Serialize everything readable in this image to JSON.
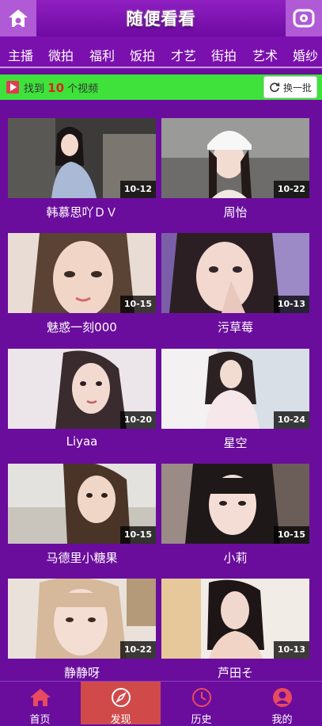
{
  "header": {
    "title": "随便看看"
  },
  "categories": [
    "主播",
    "微拍",
    "福利",
    "饭拍",
    "才艺",
    "街拍",
    "艺术",
    "婚纱"
  ],
  "findbar": {
    "prefix": "找到",
    "count": "10",
    "suffix": "个视频",
    "refresh_label": "换一批"
  },
  "videos": [
    {
      "title": "韩慕思吖ＤＶ",
      "date": "10-12"
    },
    {
      "title": "周怡",
      "date": "10-22"
    },
    {
      "title": "魅惑一刻000",
      "date": "10-15"
    },
    {
      "title": "污草莓",
      "date": "10-13"
    },
    {
      "title": "Liyaa",
      "date": "10-20"
    },
    {
      "title": "星空",
      "date": "10-24"
    },
    {
      "title": "马德里小糖果",
      "date": "10-15"
    },
    {
      "title": "小莉",
      "date": "10-15"
    },
    {
      "title": "静静呀",
      "date": "10-22"
    },
    {
      "title": "芦田そ",
      "date": "10-13"
    }
  ],
  "nav": [
    {
      "label": "首页",
      "icon": "home-icon"
    },
    {
      "label": "发现",
      "icon": "compass-icon"
    },
    {
      "label": "历史",
      "icon": "clock-icon"
    },
    {
      "label": "我的",
      "icon": "user-icon"
    }
  ],
  "colors": {
    "background": "#6a0d9c",
    "findbar": "#3ee23a",
    "active_nav": "#d04a4a",
    "highlight": "#e02020"
  }
}
